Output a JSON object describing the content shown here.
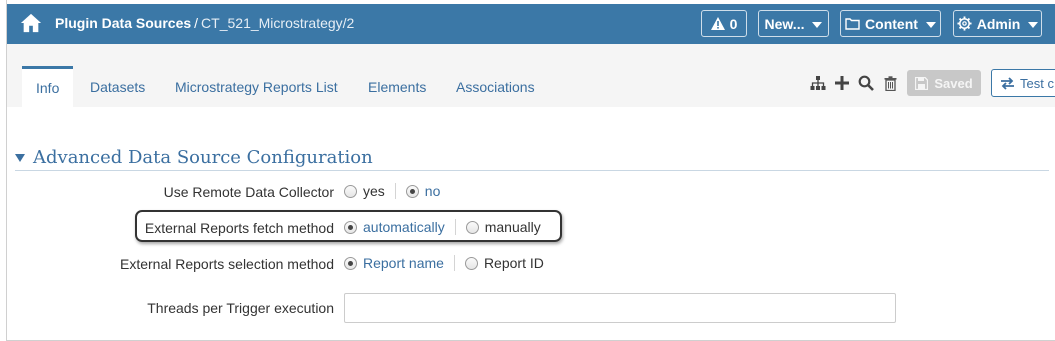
{
  "header": {
    "title": "Plugin Data Sources",
    "separator": "/",
    "path": "CT_521_Microstrategy/2",
    "alerts_count": "0",
    "new_label": "New...",
    "content_label": "Content",
    "admin_label": "Admin"
  },
  "tabs": [
    {
      "label": "Info",
      "active": true
    },
    {
      "label": "Datasets"
    },
    {
      "label": "Microstrategy Reports List"
    },
    {
      "label": "Elements"
    },
    {
      "label": "Associations"
    }
  ],
  "toolbar": {
    "saved_label": "Saved",
    "test_label": "Test c"
  },
  "section": {
    "title": "Advanced Data Source Configuration"
  },
  "fields": {
    "remote_collector": {
      "label": "Use Remote Data Collector",
      "options": [
        "yes",
        "no"
      ],
      "selected": "no"
    },
    "fetch_method": {
      "label": "External Reports fetch method",
      "options": [
        "automatically",
        "manually"
      ],
      "selected": "automatically"
    },
    "selection_method": {
      "label": "External Reports selection method",
      "options": [
        "Report name",
        "Report ID"
      ],
      "selected": "Report name"
    },
    "threads": {
      "label": "Threads per Trigger execution",
      "value": ""
    }
  },
  "colors": {
    "brand": "#3b78a7",
    "link": "#3b6fa0"
  }
}
